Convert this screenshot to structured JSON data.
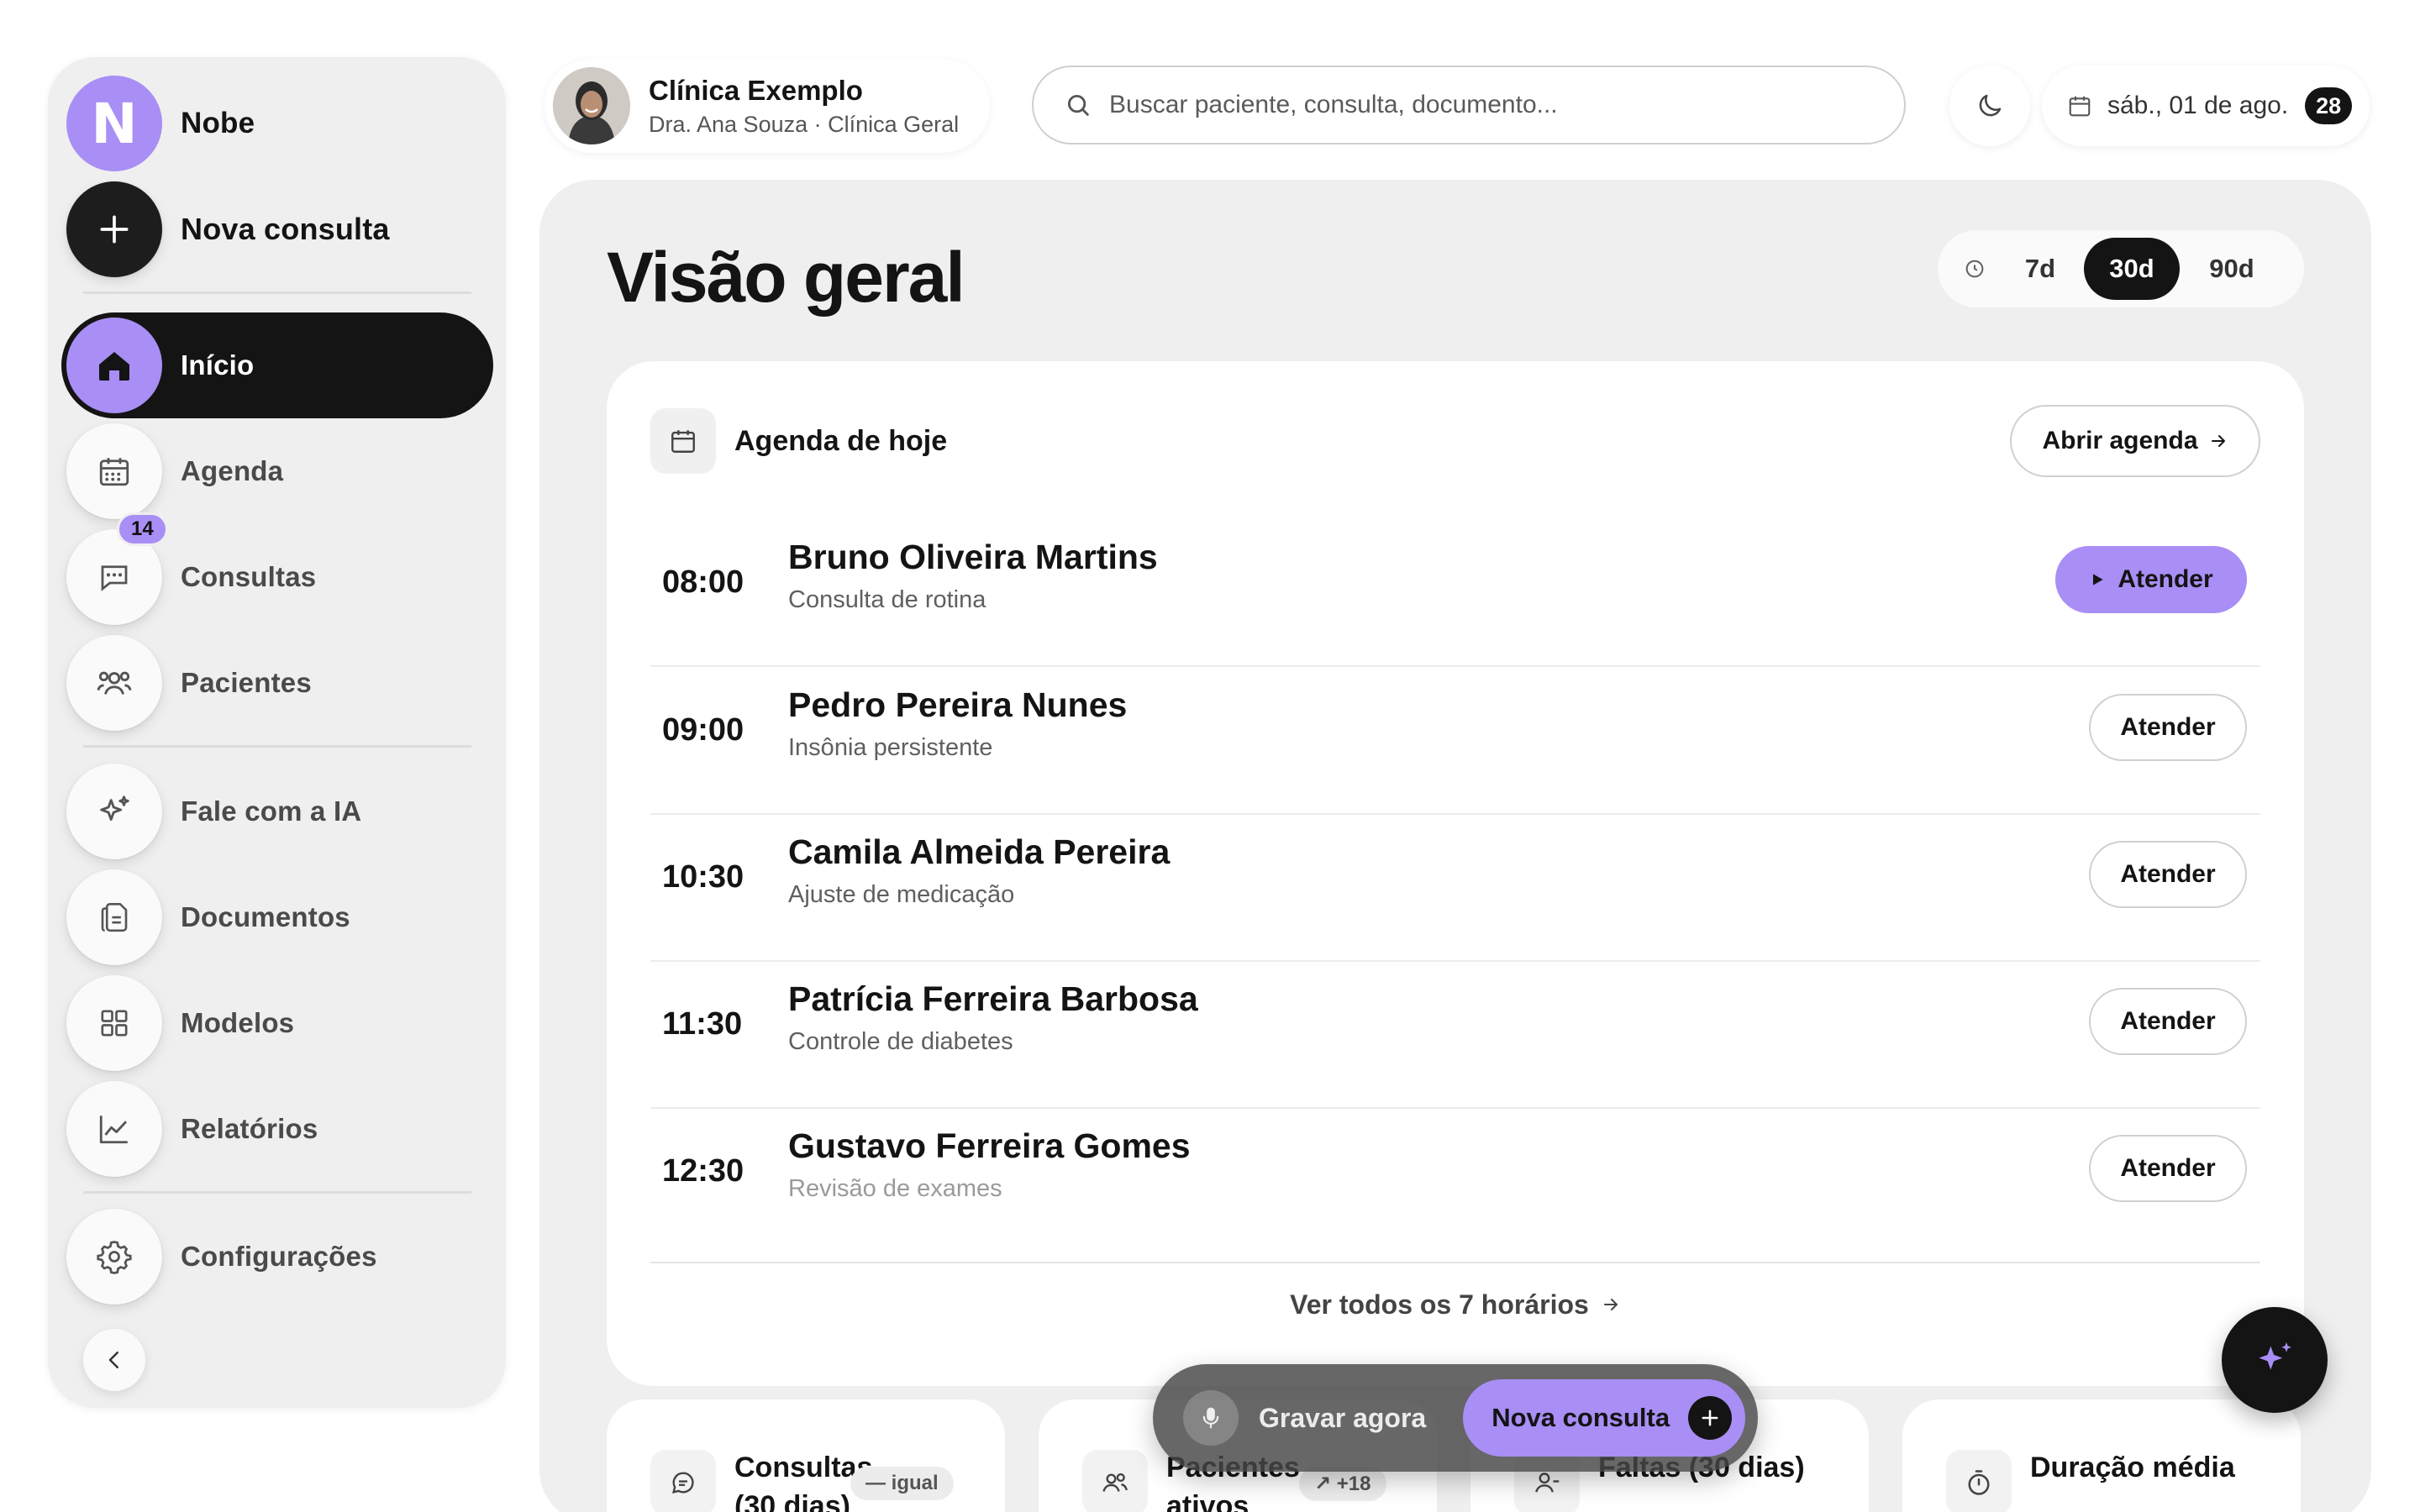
{
  "sidebar": {
    "brand": {
      "logo_letter": "N",
      "name": "Nobe"
    },
    "new_consultation": "Nova consulta",
    "items": [
      {
        "label": "Início",
        "icon": "home-icon",
        "active": true
      },
      {
        "label": "Agenda",
        "icon": "calendar-icon"
      },
      {
        "label": "Consultas",
        "icon": "chat-icon",
        "badge": "14"
      },
      {
        "label": "Pacientes",
        "icon": "users-icon"
      },
      {
        "label": "Fale com a IA",
        "icon": "sparkle-icon"
      },
      {
        "label": "Documentos",
        "icon": "document-icon"
      },
      {
        "label": "Modelos",
        "icon": "grid-icon"
      },
      {
        "label": "Relatórios",
        "icon": "chart-icon"
      },
      {
        "label": "Configurações",
        "icon": "gear-icon"
      }
    ],
    "collapse_icon": "chevron-left-icon"
  },
  "topbar": {
    "clinic_name": "Clínica Exemplo",
    "clinic_subtitle": "Dra. Ana Souza · Clínica Geral",
    "search_placeholder": "Buscar paciente, consulta, documento...",
    "theme_icon": "moon-icon",
    "date_text": "sáb., 01 de ago.",
    "date_badge": "28"
  },
  "main": {
    "title": "Visão geral",
    "range": {
      "options": [
        "7d",
        "30d",
        "90d"
      ],
      "selected": "30d"
    },
    "agenda": {
      "title": "Agenda de hoje",
      "open_button": "Abrir agenda",
      "appointments": [
        {
          "time": "08:00",
          "name": "Bruno Oliveira Martins",
          "desc": "Consulta de rotina",
          "action": "Atender",
          "primary": true
        },
        {
          "time": "09:00",
          "name": "Pedro Pereira Nunes",
          "desc": "Insônia persistente",
          "action": "Atender"
        },
        {
          "time": "10:30",
          "name": "Camila Almeida Pereira",
          "desc": "Ajuste de medicação",
          "action": "Atender"
        },
        {
          "time": "11:30",
          "name": "Patrícia Ferreira Barbosa",
          "desc": "Controle de diabetes",
          "action": "Atender"
        },
        {
          "time": "12:30",
          "name": "Gustavo Ferreira Gomes",
          "desc": "Revisão de exames",
          "action": "Atender"
        }
      ],
      "see_all": "Ver todos os 7 horários"
    },
    "stats": [
      {
        "title": "Consultas (30 dias)",
        "pill": "— igual"
      },
      {
        "title": "Pacientes ativos",
        "pill": "↗ +18"
      },
      {
        "title": "Faltas (30 dias)"
      },
      {
        "title": "Duração média"
      }
    ]
  },
  "floating_bar": {
    "record_label": "Gravar agora",
    "new_consultation": "Nova consulta"
  },
  "colors": {
    "accent": "#a98ef5",
    "dark": "#141414",
    "panel": "#efefef"
  }
}
